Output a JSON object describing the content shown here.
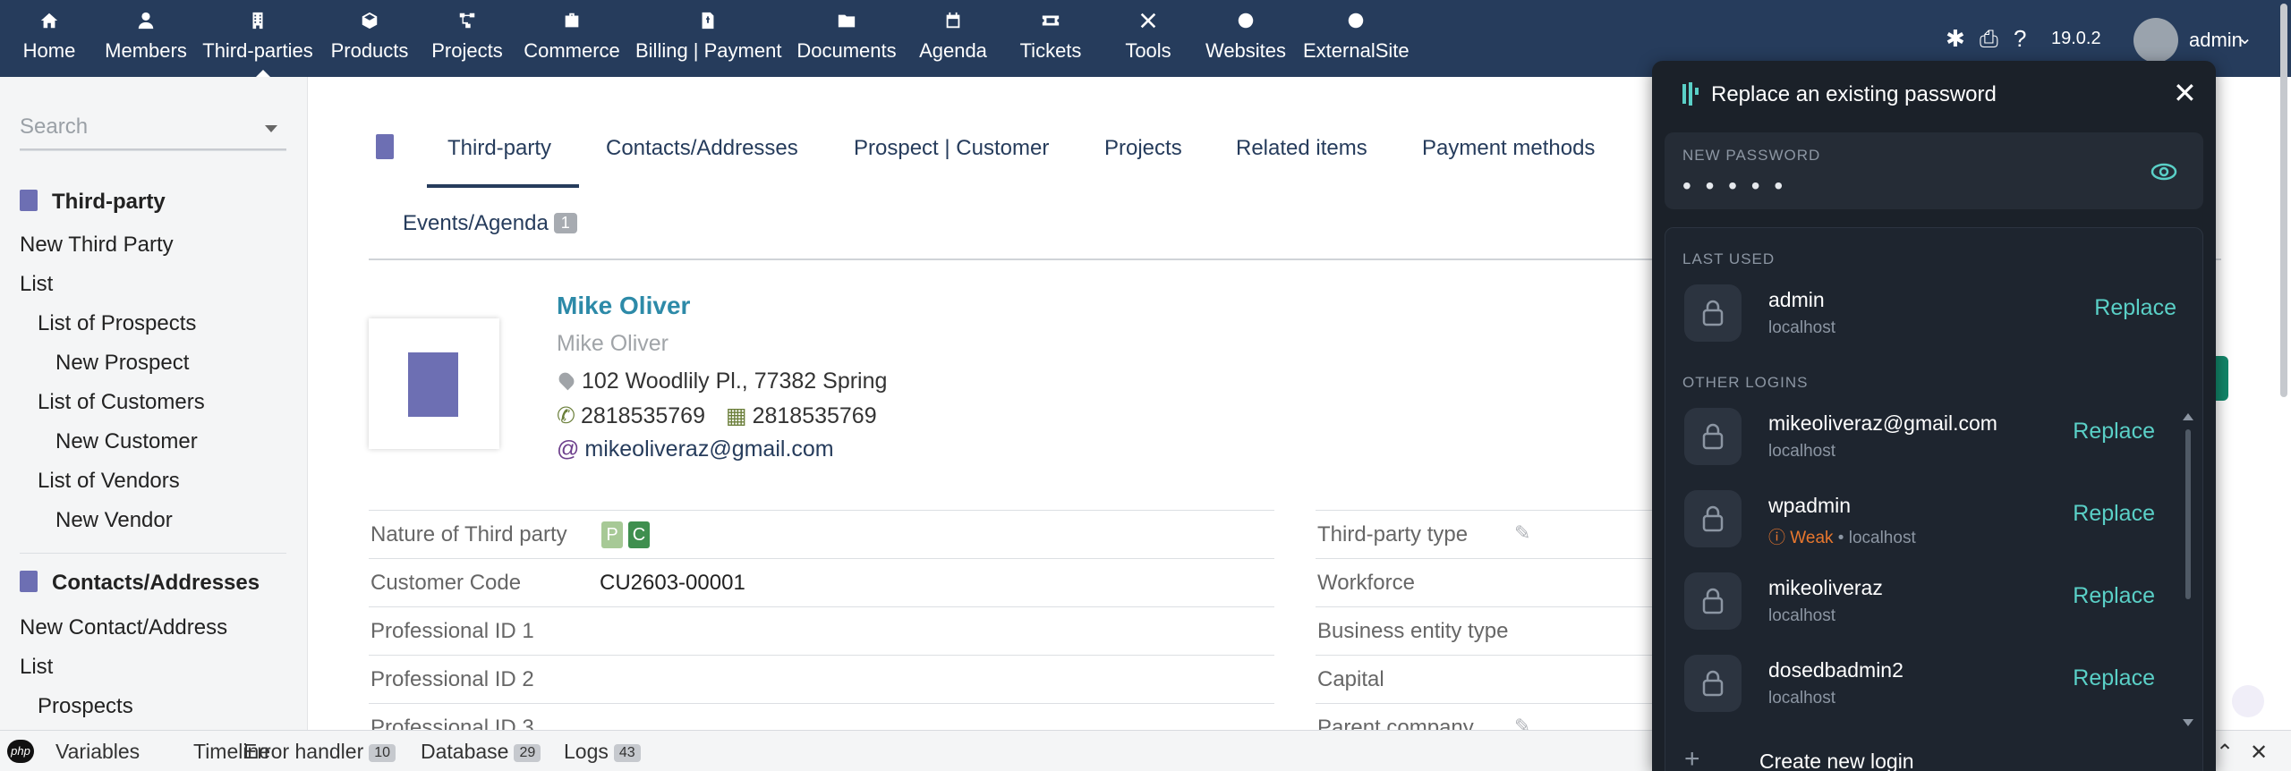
{
  "nav": {
    "items": [
      {
        "label": "Home",
        "icon": "home-icon"
      },
      {
        "label": "Members",
        "icon": "user-icon"
      },
      {
        "label": "Third-parties",
        "icon": "building-icon"
      },
      {
        "label": "Products",
        "icon": "cube-icon"
      },
      {
        "label": "Projects",
        "icon": "sitemap-icon"
      },
      {
        "label": "Commerce",
        "icon": "briefcase-icon"
      },
      {
        "label": "Billing | Payment",
        "icon": "invoice-icon"
      },
      {
        "label": "Documents",
        "icon": "folder-icon"
      },
      {
        "label": "Agenda",
        "icon": "calendar-icon"
      },
      {
        "label": "Tickets",
        "icon": "ticket-icon"
      },
      {
        "label": "Tools",
        "icon": "tools-icon"
      },
      {
        "label": "Websites",
        "icon": "globe-icon"
      },
      {
        "label": "ExternalSite",
        "icon": "globe-icon"
      }
    ],
    "version": "19.0.2",
    "user": "admin"
  },
  "sidebar": {
    "search_placeholder": "Search",
    "sections": [
      {
        "title": "Third-party",
        "links": [
          "New Third Party",
          "List",
          "List of Prospects",
          "New Prospect",
          "List of Customers",
          "New Customer",
          "List of Vendors",
          "New Vendor"
        ]
      },
      {
        "title": "Contacts/Addresses",
        "links": [
          "New Contact/Address",
          "List",
          "Prospects"
        ]
      }
    ]
  },
  "tabs": {
    "items": [
      "Third-party",
      "Contacts/Addresses",
      "Prospect | Customer",
      "Projects",
      "Related items",
      "Payment methods"
    ],
    "events_label": "Events/Agenda",
    "events_count": "1"
  },
  "card": {
    "name": "Mike Oliver",
    "alias": "Mike Oliver",
    "address": "102 Woodlily Pl., 77382 Spring",
    "phone": "2818535769",
    "fax": "2818535769",
    "email": "mikeoliveraz@gmail.com"
  },
  "fields_left": [
    {
      "label": "Nature of Third party",
      "value": ""
    },
    {
      "label": "Customer Code",
      "value": "CU2603-00001"
    },
    {
      "label": "Professional ID 1",
      "value": ""
    },
    {
      "label": "Professional ID 2",
      "value": ""
    },
    {
      "label": "Professional ID 3",
      "value": ""
    }
  ],
  "nature_badges": [
    "P",
    "C"
  ],
  "fields_right": [
    {
      "label": "Third-party type"
    },
    {
      "label": "Workforce"
    },
    {
      "label": "Business entity type"
    },
    {
      "label": "Capital"
    },
    {
      "label": "Parent company"
    }
  ],
  "debugbar": {
    "items": [
      {
        "label": "Variables",
        "count": ""
      },
      {
        "label": "Timeline",
        "count": ""
      },
      {
        "label": "Error handler",
        "count": "10"
      },
      {
        "label": "Database",
        "count": "29"
      },
      {
        "label": "Logs",
        "count": "43"
      }
    ],
    "php_logo": "php"
  },
  "password_manager": {
    "title": "Replace an existing password",
    "field_label": "NEW PASSWORD",
    "field_value": "• • • • •",
    "last_used_label": "LAST USED",
    "other_logins_label": "OTHER LOGINS",
    "replace_label": "Replace",
    "last_used": {
      "name": "admin",
      "site": "localhost"
    },
    "others": [
      {
        "name": "mikeoliveraz@gmail.com",
        "site": "localhost",
        "weak": ""
      },
      {
        "name": "wpadmin",
        "site": "localhost",
        "weak": "Weak"
      },
      {
        "name": "mikeoliveraz",
        "site": "localhost",
        "weak": ""
      },
      {
        "name": "dosedbadmin2",
        "site": "localhost",
        "weak": ""
      }
    ],
    "create_label": "Create new login"
  },
  "colors": {
    "topbar": "#263c5c",
    "accent": "#5ad0c7",
    "weak": "#e8772e",
    "prospect": "#a7c996",
    "customer": "#3f8f4f"
  }
}
